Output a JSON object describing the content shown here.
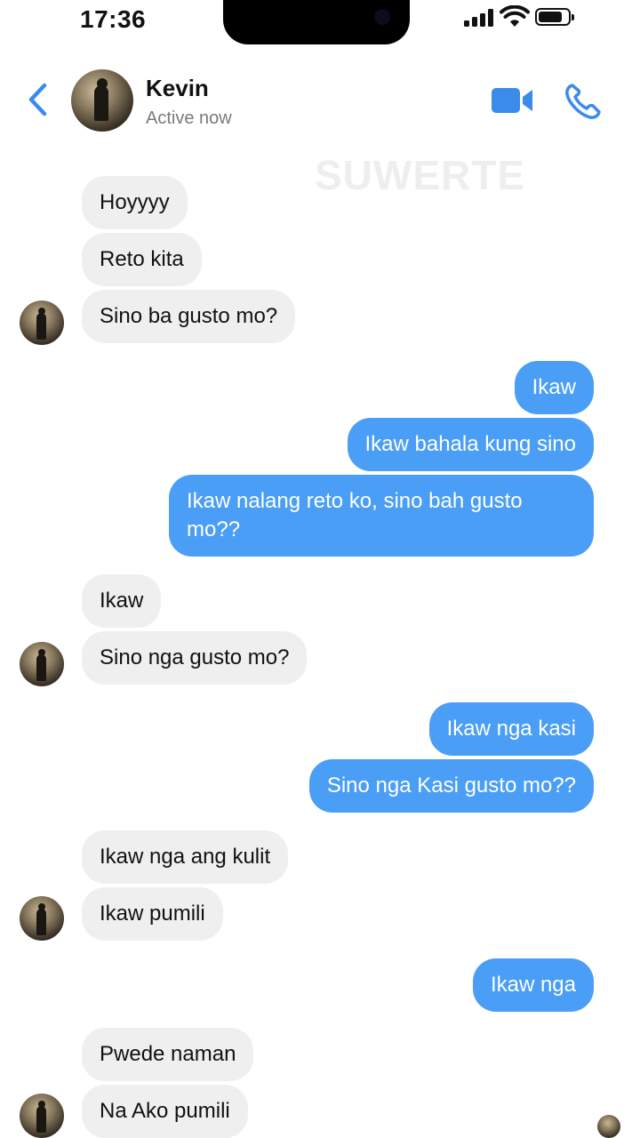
{
  "status_bar": {
    "time": "17:36"
  },
  "header": {
    "contact_name": "Kevin",
    "presence": "Active now",
    "back_icon": "chevron-left-icon",
    "video_icon": "video-camera-icon",
    "call_icon": "phone-icon",
    "accent_color": "#3b8bea"
  },
  "watermark": "SUWERTE",
  "messages": [
    {
      "side": "in",
      "text": "Hoyyyy"
    },
    {
      "side": "in",
      "text": "Reto kita"
    },
    {
      "side": "in",
      "text": "Sino ba gusto mo?"
    },
    {
      "side": "out",
      "text": "Ikaw"
    },
    {
      "side": "out",
      "text": "Ikaw bahala kung sino"
    },
    {
      "side": "out",
      "text": "Ikaw nalang reto ko, sino bah gusto mo??"
    },
    {
      "side": "in",
      "text": "Ikaw"
    },
    {
      "side": "in",
      "text": "Sino nga gusto mo?"
    },
    {
      "side": "out",
      "text": "Ikaw nga kasi"
    },
    {
      "side": "out",
      "text": "Sino nga Kasi gusto mo??"
    },
    {
      "side": "in",
      "text": "Ikaw nga ang kulit"
    },
    {
      "side": "in",
      "text": "Ikaw pumili"
    },
    {
      "side": "out",
      "text": "Ikaw nga"
    },
    {
      "side": "in",
      "text": "Pwede naman"
    },
    {
      "side": "in",
      "text": "Na Ako pumili"
    }
  ],
  "colors": {
    "outgoing_bubble": "#4a9ef5",
    "incoming_bubble": "#efefef"
  }
}
